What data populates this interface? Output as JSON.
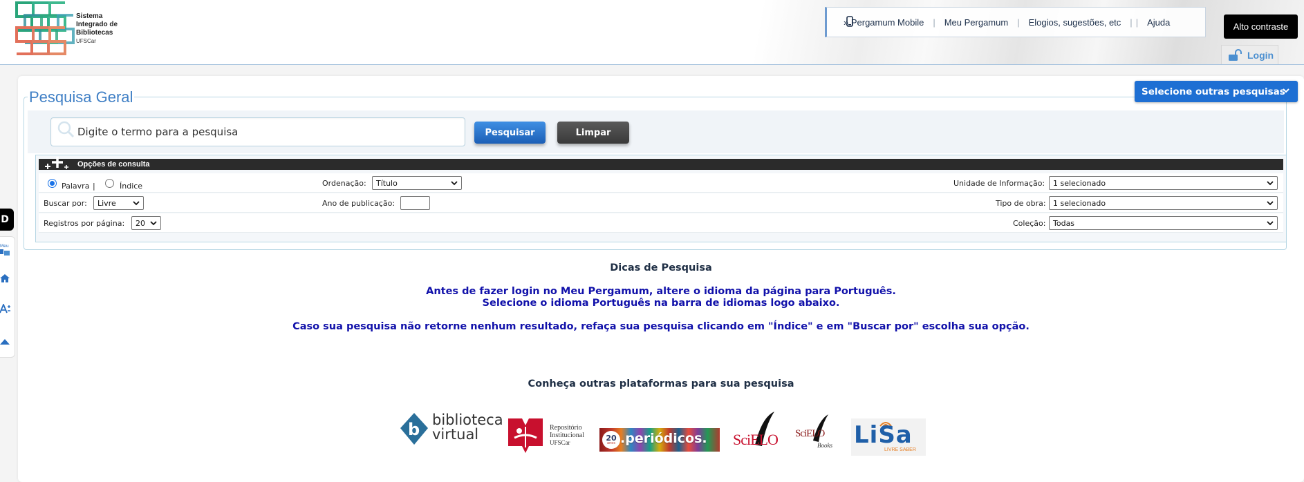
{
  "header": {
    "logo_lines": [
      "Sistema",
      "Integrado de",
      "Bibliotecas",
      "UFSCar"
    ],
    "nav": {
      "mobile": "» Pergamum Mobile",
      "meu_pergamum": "Meu Pergamum",
      "elogios": "Elogios, sugestões, etc",
      "ajuda": "Ajuda",
      "separator": "|"
    },
    "alto_contraste": "Alto contraste",
    "login": "Login"
  },
  "search": {
    "legend": "Pesquisa Geral",
    "other_searches": "Selecione outras pesquisas",
    "placeholder": "Digite o termo para a pesquisa",
    "search_button": "Pesquisar",
    "clear_button": "Limpar"
  },
  "options": {
    "title": "Opções de consulta",
    "radio_palavra": "Palavra",
    "radio_sep": "|",
    "radio_indice": "Índice",
    "buscar_por_label": "Buscar por:",
    "buscar_por_value": "Livre",
    "registros_label": "Registros por página:",
    "registros_value": "20",
    "ordenacao_label": "Ordenação:",
    "ordenacao_value": "Título",
    "ano_label": "Ano de publicação:",
    "ano_value": "",
    "unidade_label": "Unidade de Informação:",
    "unidade_value": "1 selecionado",
    "tipo_label": "Tipo de obra:",
    "tipo_value": "1 selecionado",
    "colecao_label": "Coleção:",
    "colecao_value": "Todas"
  },
  "side_tools": {
    "top_letter": "D",
    "meu_label": "Meu"
  },
  "tips": {
    "title": "Dicas de Pesquisa",
    "line1": "Antes de fazer login no Meu Pergamum, altere o idioma da página para Português.",
    "line2": "Selecione o idioma Português na barra de idiomas logo abaixo.",
    "line3": "Caso sua pesquisa não retorne nenhum resultado, refaça sua pesquisa clicando em \"Índice\" e em \"Buscar por\" escolha sua opção."
  },
  "platforms": {
    "title": "Conheça outras plataformas para sua pesquisa",
    "biblioteca": [
      "biblioteca",
      "virtual"
    ],
    "repositorio": [
      "Repositório",
      "Institucional",
      "UFSCar"
    ],
    "periodicos": ".periódicos.",
    "periodicos_badge": "20",
    "periodicos_badge_sub": "anos",
    "scielo": "SciELO",
    "scielo_books": [
      "SciELO",
      "Books"
    ],
    "lisa": "LiSa",
    "lisa_sub": "LIVRE SABER"
  },
  "colors": {
    "brand_blue": "#3f7fc5",
    "button_blue": "#1e6fd3",
    "tips_blue": "#1111aa",
    "logo_green": "#2aa57a",
    "logo_orange": "#e2705a"
  }
}
